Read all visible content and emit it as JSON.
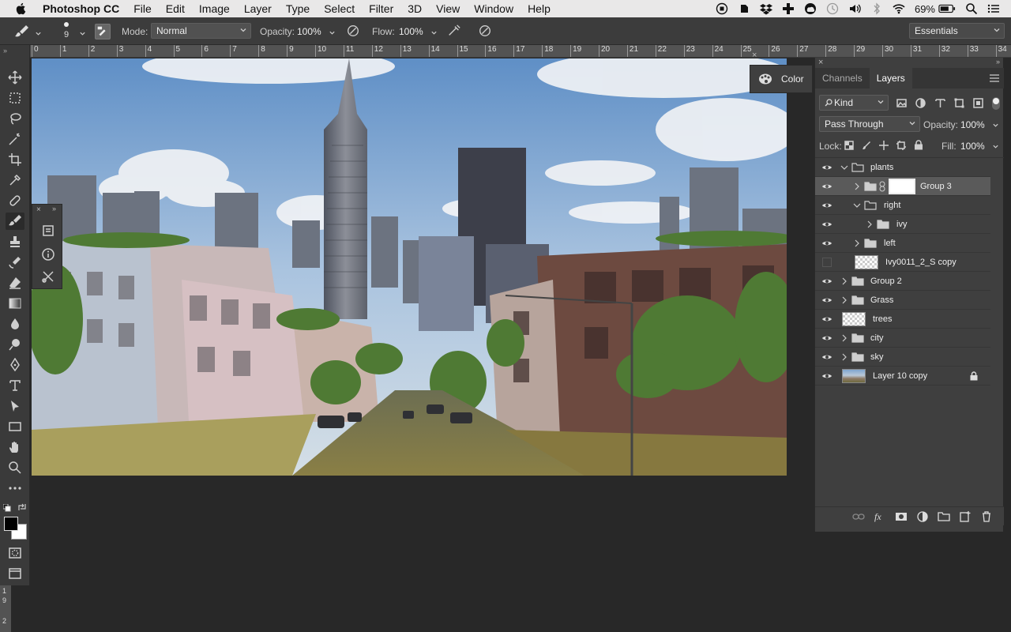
{
  "menubar": {
    "app_name": "Photoshop CC",
    "items": [
      "File",
      "Edit",
      "Image",
      "Layer",
      "Type",
      "Select",
      "Filter",
      "3D",
      "View",
      "Window",
      "Help"
    ],
    "battery": "69%"
  },
  "options": {
    "brush_size": "9",
    "mode_label": "Mode:",
    "mode_value": "Normal",
    "opacity_label": "Opacity:",
    "opacity_value": "100%",
    "flow_label": "Flow:",
    "flow_value": "100%",
    "workspace": "Essentials"
  },
  "ruler": {
    "ticks": [
      "0",
      "1",
      "2",
      "3",
      "4",
      "5",
      "6",
      "7",
      "8",
      "9",
      "10",
      "11",
      "12",
      "13",
      "14",
      "15",
      "16",
      "17",
      "18",
      "19",
      "20",
      "21",
      "22",
      "23",
      "24",
      "25",
      "26",
      "27",
      "28",
      "29",
      "30",
      "31",
      "32",
      "33",
      "34"
    ]
  },
  "vruler": {
    "labels": [
      "1",
      "9",
      "2"
    ]
  },
  "color_panel": {
    "label": "Color"
  },
  "layers_panel": {
    "tab_channels": "Channels",
    "tab_layers": "Layers",
    "filter_kind": "Kind",
    "blend_mode": "Pass Through",
    "opacity_label": "Opacity:",
    "opacity_value": "100%",
    "lock_label": "Lock:",
    "fill_label": "Fill:",
    "fill_value": "100%",
    "layers": [
      {
        "name": "plants",
        "type": "group",
        "expanded": true,
        "visible": true,
        "depth": 0
      },
      {
        "name": "Group 3",
        "type": "group",
        "expanded": false,
        "visible": true,
        "depth": 1,
        "selected": true,
        "has_mask": true
      },
      {
        "name": "right",
        "type": "group",
        "expanded": true,
        "visible": true,
        "depth": 1
      },
      {
        "name": "ivy",
        "type": "group",
        "expanded": false,
        "visible": true,
        "depth": 2
      },
      {
        "name": "left",
        "type": "group",
        "expanded": false,
        "visible": true,
        "depth": 1
      },
      {
        "name": "Ivy0011_2_S copy",
        "type": "pixel",
        "visible": false,
        "depth": 1
      },
      {
        "name": "Group 2",
        "type": "group",
        "expanded": false,
        "visible": true,
        "depth": 0
      },
      {
        "name": "Grass",
        "type": "group",
        "expanded": false,
        "visible": true,
        "depth": 0
      },
      {
        "name": "trees",
        "type": "pixel",
        "visible": true,
        "depth": 0
      },
      {
        "name": "city",
        "type": "group",
        "expanded": false,
        "visible": true,
        "depth": 0
      },
      {
        "name": "sky",
        "type": "group",
        "expanded": false,
        "visible": true,
        "depth": 0
      },
      {
        "name": "Layer 10 copy",
        "type": "image",
        "visible": true,
        "depth": 0,
        "locked": true
      }
    ]
  }
}
